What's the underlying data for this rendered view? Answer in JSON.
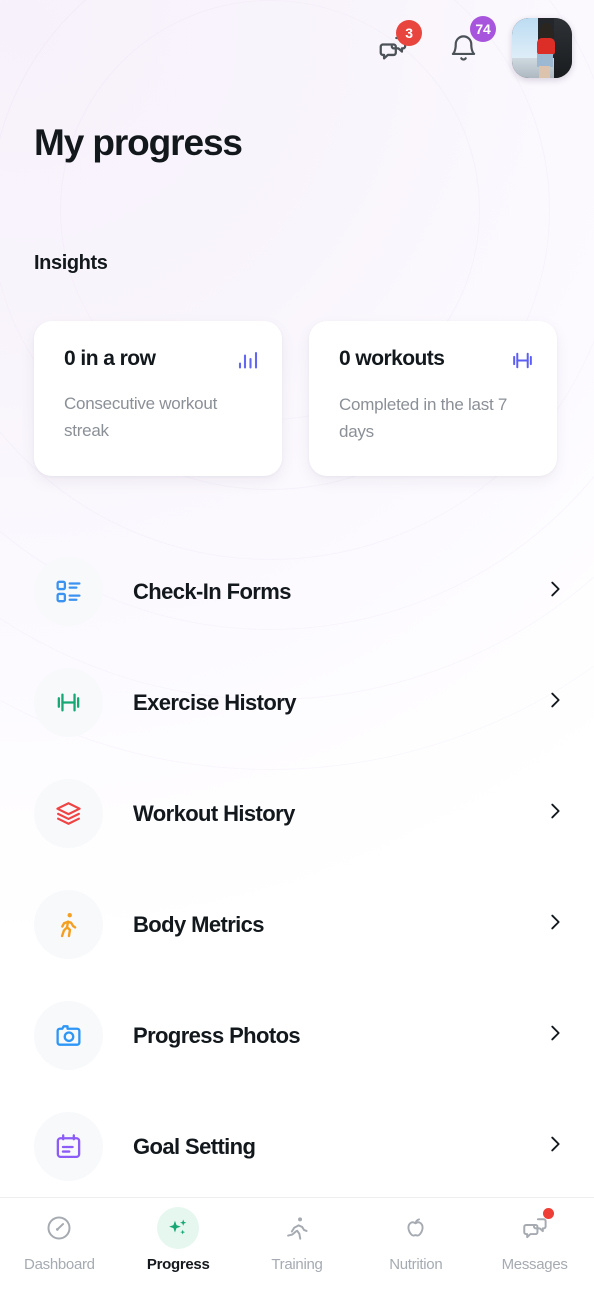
{
  "header": {
    "messages_icon": "chat-bubbles-icon",
    "messages_badge": "3",
    "notifications_icon": "bell-icon",
    "notifications_badge": "74",
    "avatar_alt": "user-avatar"
  },
  "page": {
    "title": "My progress",
    "section_label": "Insights"
  },
  "insights": [
    {
      "value": "0 in a row",
      "subtitle": "Consecutive workout streak",
      "icon": "bar-chart-icon",
      "icon_color": "#6366f1"
    },
    {
      "value": "0 workouts",
      "subtitle": "Completed in the last 7 days",
      "icon": "dumbbell-icon",
      "icon_color": "#5b5ef0"
    }
  ],
  "menu": [
    {
      "label": "Check-In Forms",
      "icon": "list-checklist-icon",
      "icon_color": "#3b92f0",
      "chevron": "chevron-right-icon"
    },
    {
      "label": "Exercise History",
      "icon": "dumbbell-icon",
      "icon_color": "#16a874",
      "chevron": "chevron-right-icon"
    },
    {
      "label": "Workout History",
      "icon": "layers-stack-icon",
      "icon_color": "#ef4444",
      "chevron": "chevron-right-icon"
    },
    {
      "label": "Body Metrics",
      "icon": "walking-person-icon",
      "icon_color": "#f59f22",
      "chevron": "chevron-right-icon"
    },
    {
      "label": "Progress Photos",
      "icon": "camera-icon",
      "icon_color": "#2e96f5",
      "chevron": "chevron-right-icon"
    },
    {
      "label": "Goal Setting",
      "icon": "calendar-icon",
      "icon_color": "#8b5cf6",
      "chevron": "chevron-right-icon"
    }
  ],
  "bottom_nav": [
    {
      "label": "Dashboard",
      "icon": "gauge-icon",
      "active": false,
      "dot": false
    },
    {
      "label": "Progress",
      "icon": "sparkles-icon",
      "active": true,
      "dot": false
    },
    {
      "label": "Training",
      "icon": "running-icon",
      "active": false,
      "dot": false
    },
    {
      "label": "Nutrition",
      "icon": "apple-icon",
      "active": false,
      "dot": false
    },
    {
      "label": "Messages",
      "icon": "chat-bubbles-icon",
      "active": false,
      "dot": true
    }
  ],
  "colors": {
    "background_tint": "#f8f2fc",
    "text_primary": "#12181c",
    "text_muted": "#8b9097",
    "badge_red": "#e8453f",
    "badge_purple": "#a855dd",
    "accent_green": "#16a874",
    "icon_circle": "#f7f9fb"
  }
}
